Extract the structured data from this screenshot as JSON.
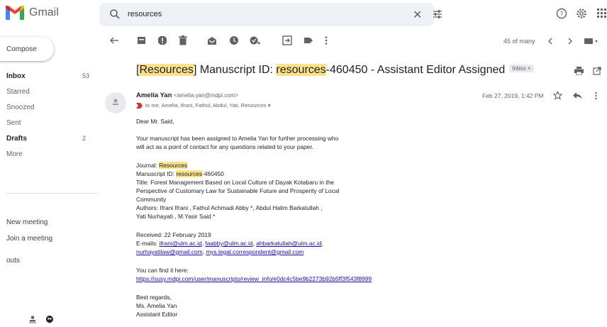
{
  "app": {
    "name": "Gmail"
  },
  "search": {
    "query": "resources"
  },
  "sidebar": {
    "compose": "Compose",
    "items": [
      {
        "label": "Inbox",
        "count": "53"
      },
      {
        "label": "Starred",
        "count": ""
      },
      {
        "label": "Snoozed",
        "count": ""
      },
      {
        "label": "Sent",
        "count": ""
      },
      {
        "label": "Drafts",
        "count": "2"
      },
      {
        "label": "More",
        "count": ""
      }
    ],
    "meet": [
      "New meeting",
      "Join a meeting"
    ],
    "hangouts": "outs"
  },
  "toolbar": {
    "pager": "45 of many"
  },
  "subject": {
    "bracket_open": "[",
    "word1": "Resources",
    "mid": "] Manuscript ID: ",
    "word2": "resources",
    "rest": "-460450 - Assistant Editor Assigned",
    "label": "Inbox ×"
  },
  "message": {
    "sender_name": "Amelia Yan",
    "sender_email": "<amelia.yan@mdpi.com>",
    "recipients": "to me, Amelia, Ifrani, Fathul, Abdul, Yati, Resources ▾",
    "date": "Feb 27, 2019, 1:42 PM",
    "greeting": "Dear Mr. Said,",
    "p1_l1": "Your manuscript has been assigned to Amelia Yan for further processing who",
    "p1_l2": "will act as a point of contact for any questions related to your paper.",
    "journal_label": "Journal: ",
    "journal_value": "Resources",
    "msid_label": "Manuscript ID: ",
    "msid_hl": "resources",
    "msid_rest": "-460450",
    "title_l1": "Title: Forest Management Based on Local Culture of Dayak Kotabaru in the",
    "title_l2": "Perspective of Customary Law for Sustainable Future and Prosperity of Local",
    "title_l3": "Community",
    "authors_l1": "Authors: Ifrani Ifrani , Fathul Achmadi Abby *, Abdul Halim Barkatullah ,",
    "authors_l2": "Yati Nurhayati , M.Yasir Said *",
    "received": "Received: 22 February 2019",
    "emails_label": "E-mails: ",
    "emails_l1": [
      "ifrani@ulm.ac.id",
      "faabby@ulm.ac.id",
      "ahbarkatullah@ulm.ac.id"
    ],
    "emails_l2": [
      "nurhayatilaw@gmail.com",
      "mys.legal.correspondent@gmail.com"
    ],
    "find_it": "You can find it here:",
    "url": "https://susy.mdpi.com/user/manuscripts/review_info/e0dc4c5be9b2273b92b5ff3f543f8999",
    "regards": "Best regards,",
    "sig_name": "Ms. Amelia Yan",
    "sig_role": "Assistant Editor"
  }
}
